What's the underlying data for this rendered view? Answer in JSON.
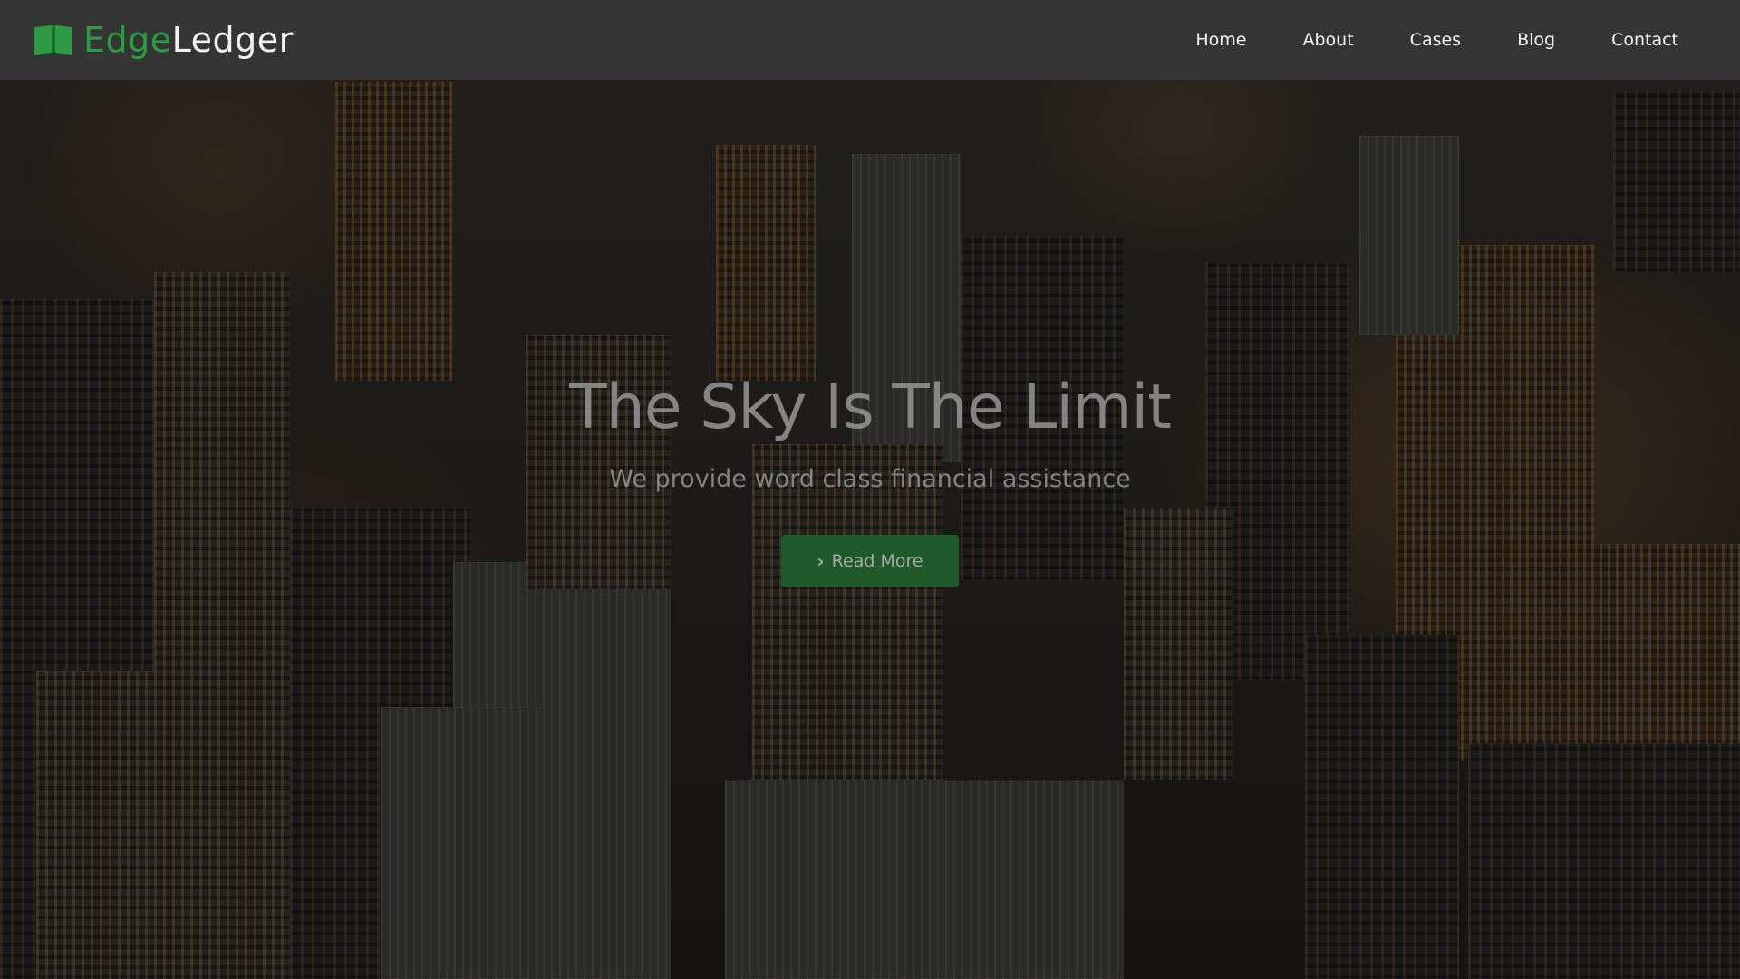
{
  "brand": {
    "name_part1": "Edge",
    "name_part2": "Ledger",
    "logo_icon": "open-book-icon",
    "accent_color": "#2f9a44"
  },
  "nav": {
    "items": [
      {
        "label": "Home"
      },
      {
        "label": "About"
      },
      {
        "label": "Cases"
      },
      {
        "label": "Blog"
      },
      {
        "label": "Contact"
      }
    ]
  },
  "hero": {
    "title": "The Sky Is The Limit",
    "subtitle": "We provide word class financial assistance",
    "cta_label": "Read More",
    "cta_icon": "chevron-right-icon",
    "cta_color": "#1f5a2a",
    "background": "city-skyline-at-night-photo"
  }
}
